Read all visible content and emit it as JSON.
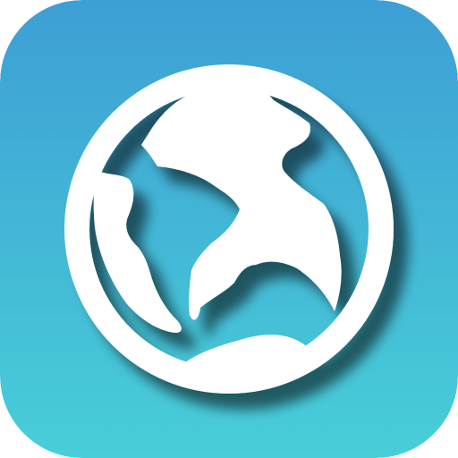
{
  "app_icon": {
    "name": "globe-app-icon",
    "icon": "globe-icon",
    "colors": {
      "gradient_top": "#3d9fd4",
      "gradient_bottom": "#48ced8",
      "glyph": "#ffffff",
      "shadow": "#000000"
    }
  }
}
